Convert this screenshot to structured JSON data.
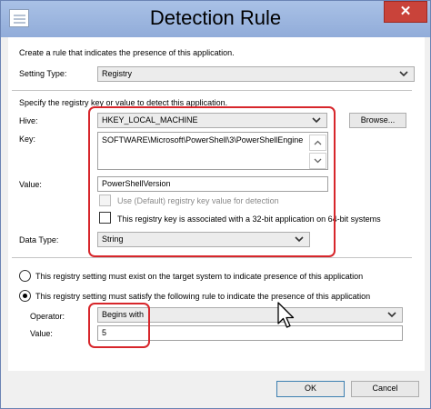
{
  "window": {
    "title": "Detection Rule",
    "close_label": "✕"
  },
  "intro": "Create a rule that indicates the presence of this application.",
  "setting_type": {
    "label": "Setting Type:",
    "value": "Registry"
  },
  "registry": {
    "instruction": "Specify the registry key or value to detect this application.",
    "hive_label": "Hive:",
    "hive_value": "HKEY_LOCAL_MACHINE",
    "browse_label": "Browse...",
    "key_label": "Key:",
    "key_value": "SOFTWARE\\Microsoft\\PowerShell\\3\\PowerShellEngine",
    "value_label": "Value:",
    "value_value": "PowerShellVersion",
    "default_value_checkbox": "Use (Default) registry key value for detection",
    "default_value_checked": false,
    "default_value_enabled": false,
    "wow64_checkbox": "This registry key is associated with a 32-bit application on 64-bit systems",
    "wow64_checked": false,
    "data_type_label": "Data Type:",
    "data_type_value": "String"
  },
  "rules": {
    "exist_option": "This registry setting must exist on the target system to indicate presence of this application",
    "exist_selected": false,
    "satisfy_option": "This registry setting must satisfy the following rule to indicate the presence of this application",
    "satisfy_selected": true,
    "operator_label": "Operator:",
    "operator_value": "Begins with",
    "value_label": "Value:",
    "value_value": "5"
  },
  "buttons": {
    "ok": "OK",
    "cancel": "Cancel"
  },
  "colors": {
    "highlight": "#d7262b",
    "title_bar": "#a9c1e6",
    "close_button": "#c9433a"
  }
}
